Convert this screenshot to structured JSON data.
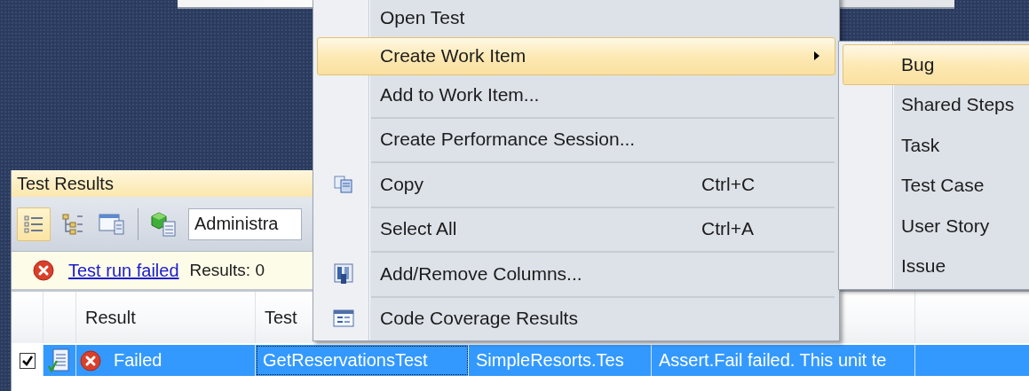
{
  "test_results": {
    "title": "Test Results",
    "view_buttons": [
      {
        "selected": true
      },
      {
        "selected": false
      },
      {
        "selected": false
      }
    ],
    "run_selector": {
      "value": "Administra"
    },
    "status": {
      "link": "Test run failed",
      "text": "Results: 0"
    },
    "table": {
      "columns": [
        "Result",
        "Test"
      ],
      "rows": [
        {
          "checked": true,
          "selected": true,
          "cells": [
            "Failed",
            "GetReservationsTest",
            "SimpleResorts.Tes",
            "Assert.Fail failed. This unit te"
          ]
        }
      ]
    }
  },
  "context_menu": {
    "items": [
      {
        "label": "Open Test",
        "highlighted": false,
        "separator_before": false,
        "has_submenu": false
      },
      {
        "label": "Create Work Item",
        "highlighted": true,
        "separator_before": false,
        "has_submenu": true
      },
      {
        "label": "Add to Work Item...",
        "highlighted": false,
        "separator_before": false,
        "has_submenu": false
      },
      {
        "label": "Create Performance Session...",
        "highlighted": false,
        "separator_before": true,
        "has_submenu": false
      },
      {
        "label": "Copy",
        "shortcut": "Ctrl+C",
        "highlighted": false,
        "separator_before": true,
        "has_submenu": false
      },
      {
        "label": "Select All",
        "shortcut": "Ctrl+A",
        "highlighted": false,
        "separator_before": true,
        "has_submenu": false
      },
      {
        "label": "Add/Remove Columns...",
        "highlighted": false,
        "separator_before": true,
        "has_submenu": false
      },
      {
        "label": "Code Coverage Results",
        "highlighted": false,
        "separator_before": true,
        "has_submenu": false
      }
    ]
  },
  "submenu": {
    "items": [
      {
        "label": "Bug",
        "highlighted": true
      },
      {
        "label": "Shared Steps",
        "highlighted": false
      },
      {
        "label": "Task",
        "highlighted": false
      },
      {
        "label": "Test Case",
        "highlighted": false
      },
      {
        "label": "User Story",
        "highlighted": false
      },
      {
        "label": "Issue",
        "highlighted": false
      }
    ]
  }
}
